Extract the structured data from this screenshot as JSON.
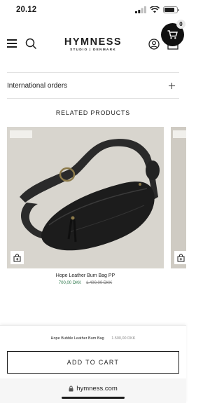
{
  "status_bar": {
    "time": "20.12",
    "battery_level": 0.8
  },
  "header": {
    "logo": "HYMNESS",
    "logo_sub": "STUDIO | DENMARK",
    "cart_count": "0",
    "icons": [
      "menu-icon",
      "search-icon",
      "account-icon",
      "cart-icon"
    ]
  },
  "accordion": {
    "label": "International orders"
  },
  "related": {
    "title": "RELATED PRODUCTS",
    "products": [
      {
        "name": "Hope Leather Bum Bag PP",
        "sale_price": "700,00 DKK",
        "original_price": "1.400,00 DKK"
      }
    ]
  },
  "sticky": {
    "product_name": "Hope Bubble Leather Bum Bag",
    "price": "1.500,00 DKK",
    "add_to_cart": "ADD TO CART"
  },
  "browser": {
    "url": "hymness.com"
  },
  "colors": {
    "sale_green": "#2f7a4d",
    "text_dark": "#1d1d1d",
    "cart_bubble": "#111111"
  }
}
